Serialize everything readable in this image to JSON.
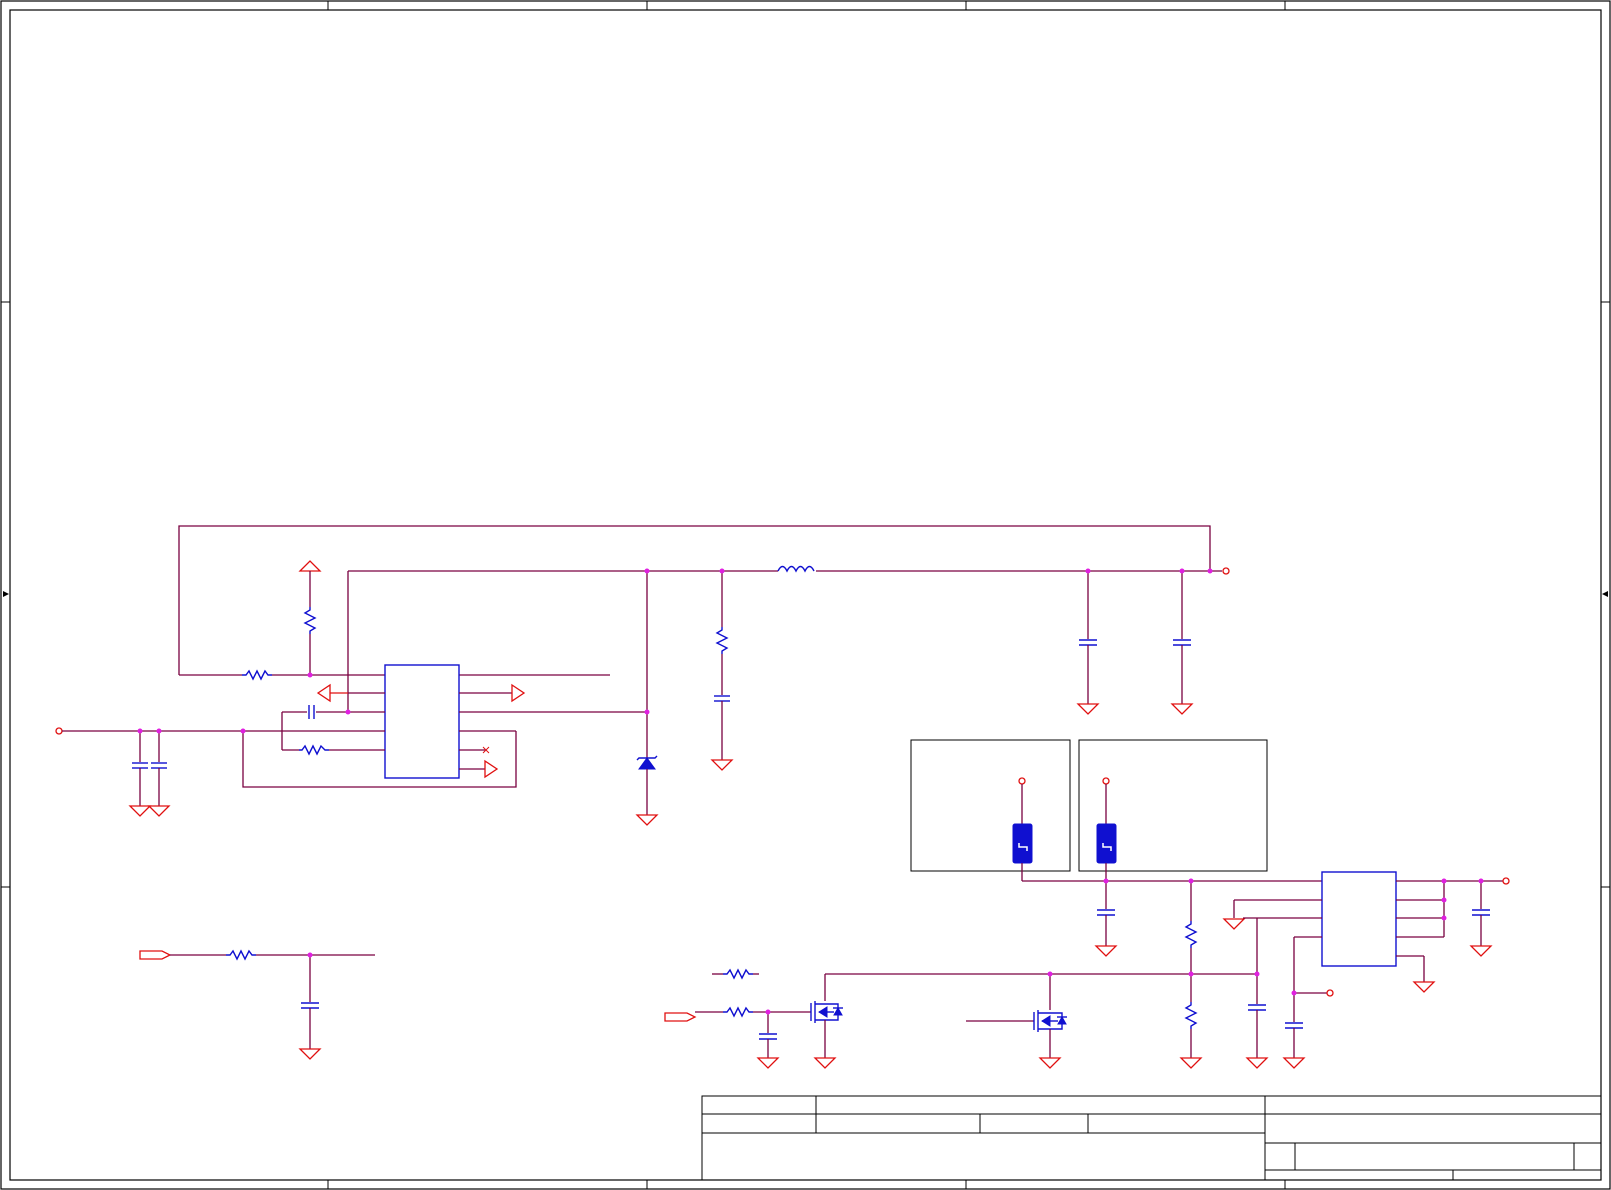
{
  "window": {
    "title": ""
  },
  "sheet": {
    "zone_columns": [
      "",
      "",
      "",
      "",
      ""
    ],
    "zone_rows": [
      "",
      "",
      ""
    ]
  },
  "title_block": {
    "company": "",
    "title": "",
    "size": "",
    "document_number": "",
    "revision": "",
    "date": "",
    "sheet": ""
  },
  "colors": {
    "wire": "#7a0040",
    "power_symbol": "#e01010",
    "component": "#1010d0",
    "junction": "#e020e0",
    "frame": "#000000"
  },
  "components": {
    "resistor_symbol": "resistor-icon",
    "capacitor_symbol": "capacitor-icon",
    "inductor_symbol": "inductor-icon",
    "ground_symbol": "ground-icon",
    "zener_symbol": "zener-diode-icon",
    "mosfet_symbol": "n-mosfet-icon",
    "fuse_symbol": "fuse-icon",
    "ic_symbol": "ic-block-icon"
  }
}
